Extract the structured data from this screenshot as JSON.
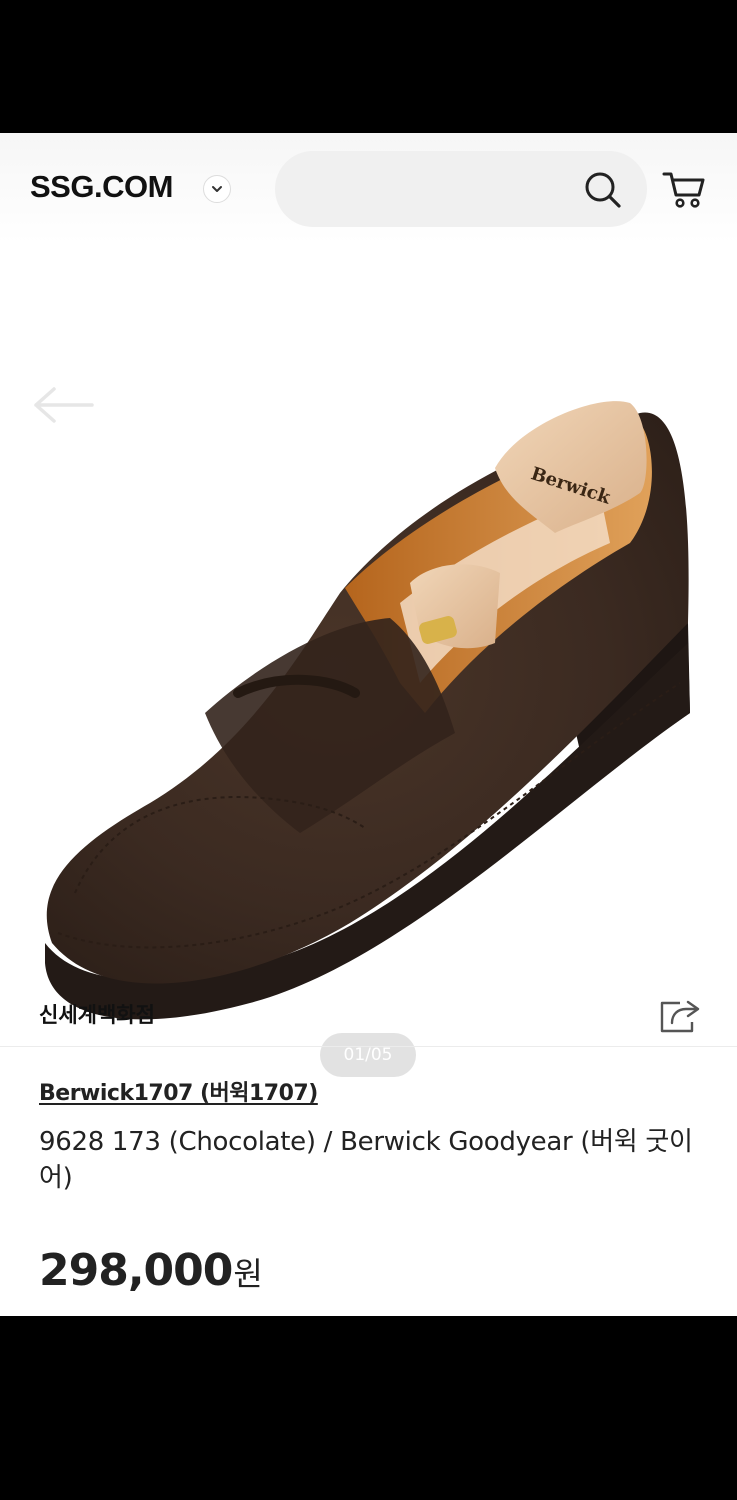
{
  "header": {
    "logo": "SSG.COM",
    "search_placeholder": ""
  },
  "icons": {
    "logo_toggle": "chevron-down-icon",
    "search": "search-icon",
    "cart": "cart-icon",
    "back": "arrow-left-icon",
    "share": "share-icon"
  },
  "gallery": {
    "indicator": "01/05"
  },
  "store": {
    "name": "신세계백화점"
  },
  "product": {
    "brand": "Berwick1707 (버윅1707)",
    "title": "9628 173 (Chocolate) / Berwick Goodyear (버윅 굿이어)",
    "price": "298,000",
    "price_unit": "원",
    "color_name": "Chocolate"
  },
  "colors": {
    "shoe": "#3b2a21",
    "sole": "#231a16",
    "shoe_tree": "#e8c7a5"
  }
}
